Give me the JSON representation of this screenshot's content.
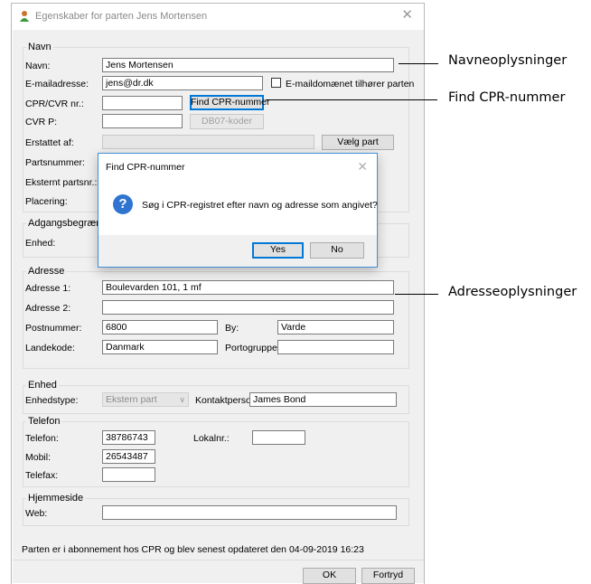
{
  "window": {
    "title": "Egenskaber for parten Jens Mortensen"
  },
  "navn_group": {
    "title": "Navn",
    "navn_label": "Navn:",
    "navn_value": "Jens Mortensen",
    "email_label": "E-mailadresse:",
    "email_value": "jens@dr.dk",
    "email_domain_checkbox_label": "E-maildomænet tilhører parten",
    "cpr_label": "CPR/CVR nr.:",
    "cpr_value": "",
    "find_cpr_button": "Find CPR-nummer",
    "cvrp_label": "CVR P:",
    "cvrp_value": "",
    "db07_button": "DB07-koder",
    "erstattet_label": "Erstattet af:",
    "erstattet_value": "",
    "vaelg_part_button": "Vælg part",
    "partsnummer_label": "Partsnummer:",
    "eksternt_label": "Eksternt partsnr.:",
    "placering_label": "Placering:"
  },
  "adgang_group": {
    "title": "Adgangsbegrænsning",
    "enhed_label": "Enhed:"
  },
  "adresse_group": {
    "title": "Adresse",
    "adresse1_label": "Adresse 1:",
    "adresse1_value": "Boulevarden 101, 1 mf",
    "adresse2_label": "Adresse 2:",
    "adresse2_value": "",
    "postnummer_label": "Postnummer:",
    "postnummer_value": "6800",
    "by_label": "By:",
    "by_value": "Varde",
    "landekode_label": "Landekode:",
    "landekode_value": "Danmark",
    "portogruppe_label": "Portogruppe:",
    "portogruppe_value": ""
  },
  "enhed_group": {
    "title": "Enhed",
    "enhedstype_label": "Enhedstype:",
    "enhedstype_value": "Ekstern part",
    "kontaktperson_label": "Kontaktperson:",
    "kontaktperson_value": "James Bond"
  },
  "telefon_group": {
    "title": "Telefon",
    "telefon_label": "Telefon:",
    "telefon_value": "38786743",
    "lokalnr_label": "Lokalnr.:",
    "lokalnr_value": "",
    "mobil_label": "Mobil:",
    "mobil_value": "26543487",
    "telefax_label": "Telefax:",
    "telefax_value": ""
  },
  "hjemmeside_group": {
    "title": "Hjemmeside",
    "web_label": "Web:",
    "web_value": ""
  },
  "status_text": "Parten er i abonnement hos CPR og blev senest opdateret den 04-09-2019 16:23",
  "footer": {
    "ok_button": "OK",
    "cancel_button": "Fortryd"
  },
  "dialog": {
    "title": "Find CPR-nummer",
    "message": "Søg i CPR-registret efter navn og adresse som angivet?",
    "yes_button": "Yes",
    "no_button": "No"
  },
  "callouts": {
    "navneoplysninger": "Navneoplysninger",
    "find_cpr": "Find CPR-nummer",
    "adresseoplysninger": "Adresseoplysninger"
  },
  "colors": {
    "focus_blue": "#0078d7",
    "question_icon": "#2f74d0"
  }
}
